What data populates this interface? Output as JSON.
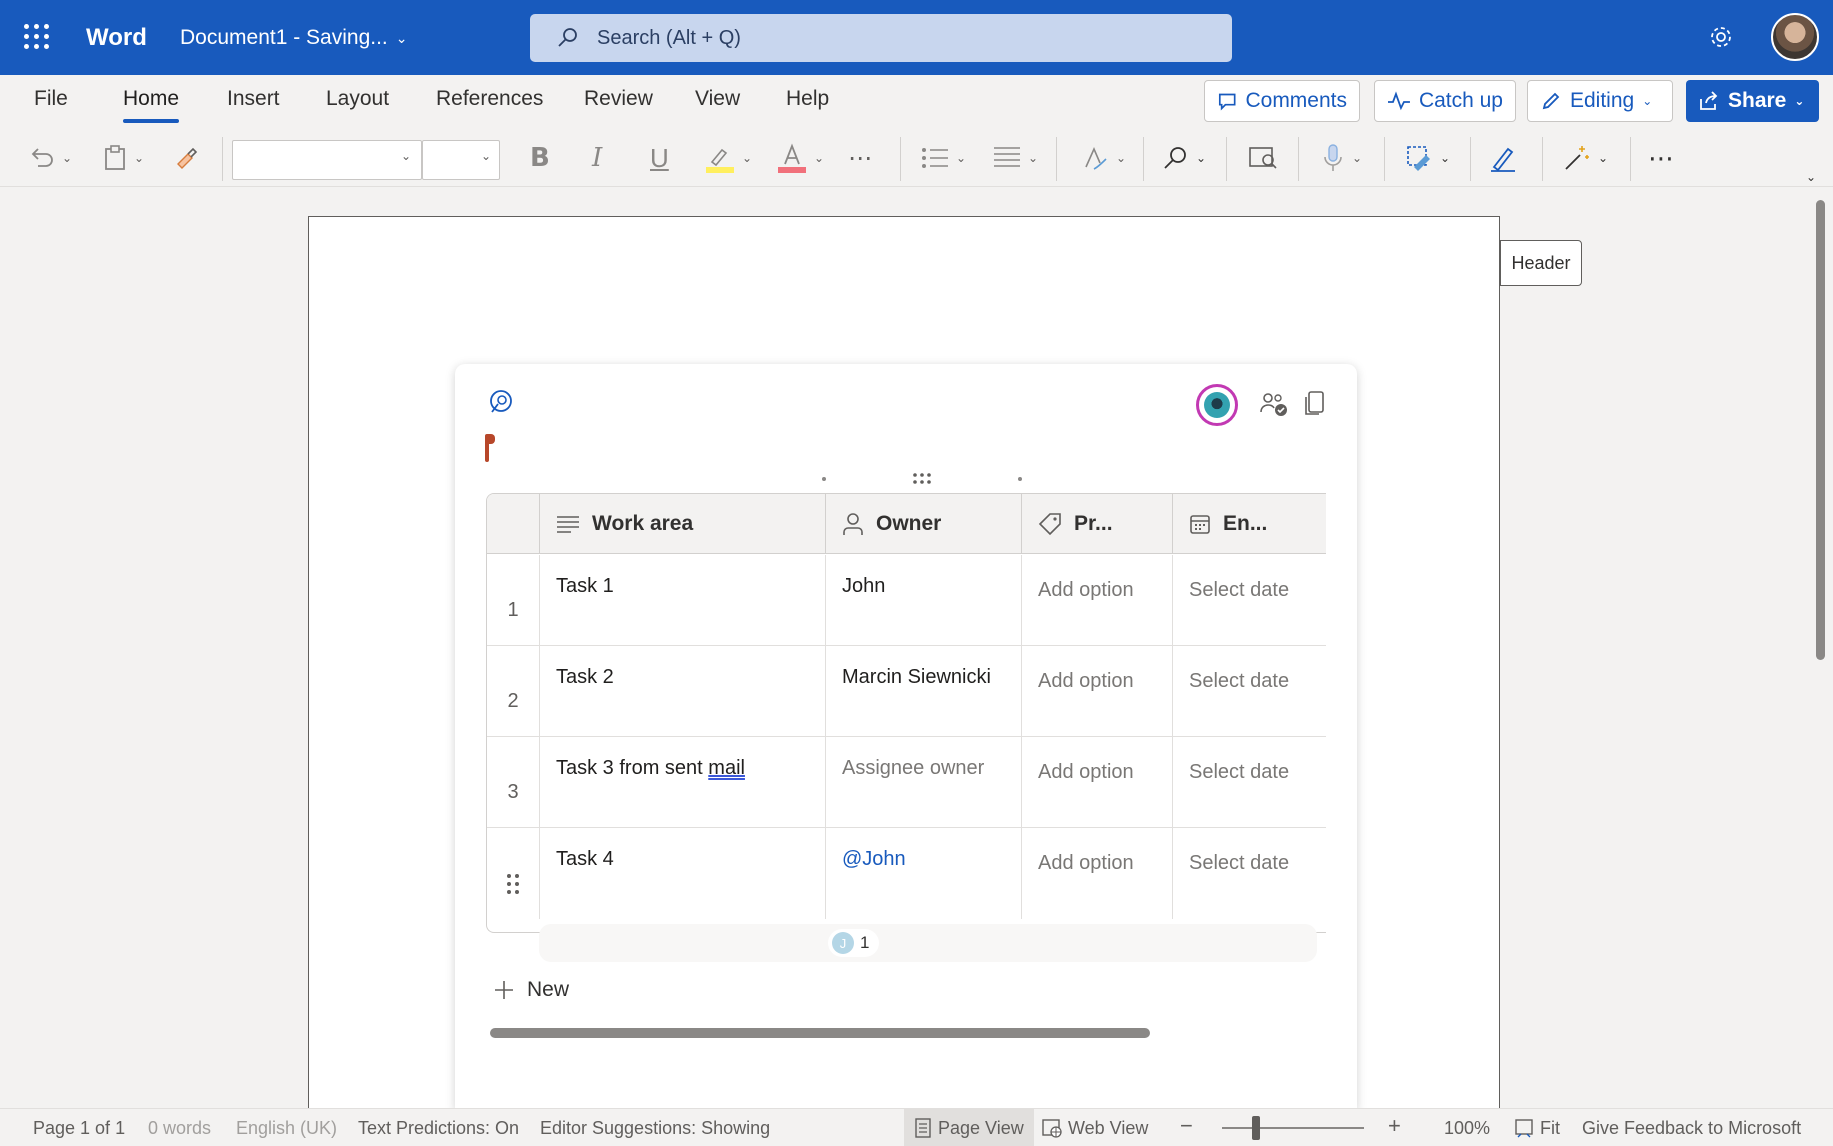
{
  "titlebar": {
    "app_name": "Word",
    "document_name": "Document1  -  Saving...",
    "search_placeholder": "Search (Alt + Q)"
  },
  "menubar": {
    "items": [
      "File",
      "Home",
      "Insert",
      "Layout",
      "References",
      "Review",
      "View",
      "Help"
    ],
    "active": "Home",
    "comments_label": "Comments",
    "catchup_label": "Catch up",
    "editing_label": "Editing",
    "share_label": "Share"
  },
  "document": {
    "header_label": "Header"
  },
  "loop_table": {
    "columns": [
      "Work area",
      "Owner",
      "Pr...",
      "En..."
    ],
    "rows": [
      {
        "index": "1",
        "work_area": "Task 1",
        "owner": "John",
        "priority": "Add option",
        "end": "Select date"
      },
      {
        "index": "2",
        "work_area": "Task 2",
        "owner": "Marcin Siewnicki",
        "priority": "Add option",
        "end": "Select date"
      },
      {
        "index": "3",
        "work_area_prefix": "Task 3 from sent ",
        "work_area_flagged": "mail",
        "owner": "Assignee owner",
        "priority": "Add option",
        "end": "Select date"
      },
      {
        "index": "",
        "work_area": "Task 4",
        "owner": "@John",
        "priority": "Add option",
        "end": "Select date"
      }
    ],
    "presence_initial": "J",
    "presence_count": "1",
    "new_label": "New"
  },
  "statusbar": {
    "page": "Page 1 of 1",
    "words": "0 words",
    "language": "English (UK)",
    "text_predictions": "Text Predictions: On",
    "editor_suggestions": "Editor Suggestions: Showing",
    "page_view": "Page View",
    "web_view": "Web View",
    "zoom": "100%",
    "fit": "Fit",
    "feedback": "Give Feedback to Microsoft"
  },
  "colors": {
    "brand": "#185abd",
    "presence_ring": "#c239b3"
  }
}
